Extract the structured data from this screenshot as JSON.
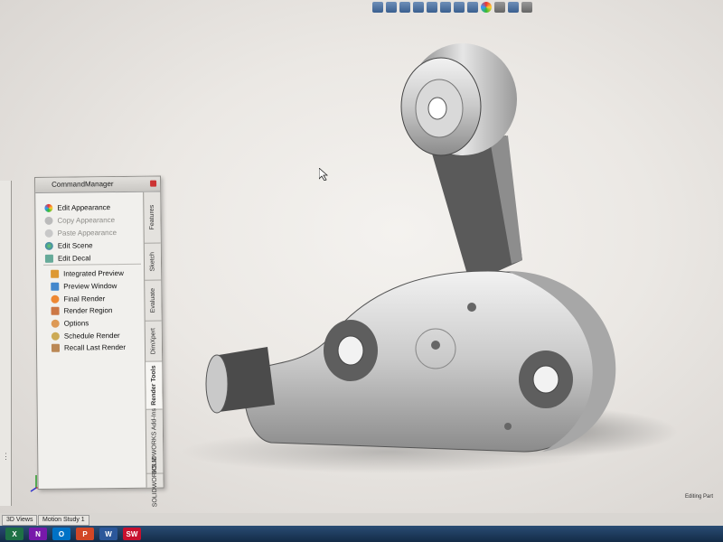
{
  "command_manager": {
    "title": "CommandManager",
    "items_appearance": [
      {
        "label": "Edit Appearance",
        "enabled": true,
        "icon": "appearance-wheel-icon"
      },
      {
        "label": "Copy Appearance",
        "enabled": false,
        "icon": "copy-appearance-icon"
      },
      {
        "label": "Paste Appearance",
        "enabled": false,
        "icon": "paste-appearance-icon"
      },
      {
        "label": "Edit Scene",
        "enabled": true,
        "icon": "scene-icon"
      },
      {
        "label": "Edit Decal",
        "enabled": true,
        "icon": "decal-icon"
      }
    ],
    "items_render": [
      {
        "label": "Integrated Preview",
        "icon": "integrated-preview-icon"
      },
      {
        "label": "Preview Window",
        "icon": "preview-window-icon"
      },
      {
        "label": "Final Render",
        "icon": "final-render-icon"
      },
      {
        "label": "Render Region",
        "icon": "render-region-icon"
      },
      {
        "label": "Options",
        "icon": "options-icon"
      },
      {
        "label": "Schedule Render",
        "icon": "schedule-render-icon"
      },
      {
        "label": "Recall Last Render",
        "icon": "recall-render-icon"
      }
    ],
    "tabs": [
      "Features",
      "Sketch",
      "Evaluate",
      "DimXpert",
      "Render Tools",
      "SOLIDWORKS Add-Ins",
      "SOLIDWORKS M"
    ]
  },
  "status": {
    "editing": "Editing Part"
  },
  "model_tabs": [
    "3D Views",
    "Motion Study 1"
  ],
  "taskbar_apps": [
    {
      "name": "excel-icon",
      "glyph": "X",
      "color": "#1e7145"
    },
    {
      "name": "onenote-icon",
      "glyph": "N",
      "color": "#7719aa"
    },
    {
      "name": "outlook-icon",
      "glyph": "O",
      "color": "#0072c6"
    },
    {
      "name": "powerpoint-icon",
      "glyph": "P",
      "color": "#d24726"
    },
    {
      "name": "word-icon",
      "glyph": "W",
      "color": "#2b579a"
    },
    {
      "name": "solidworks-icon",
      "glyph": "SW",
      "color": "#c8102e"
    }
  ],
  "colors": {
    "taskbar": "#1b3a5e",
    "accent": "#c8102e"
  }
}
